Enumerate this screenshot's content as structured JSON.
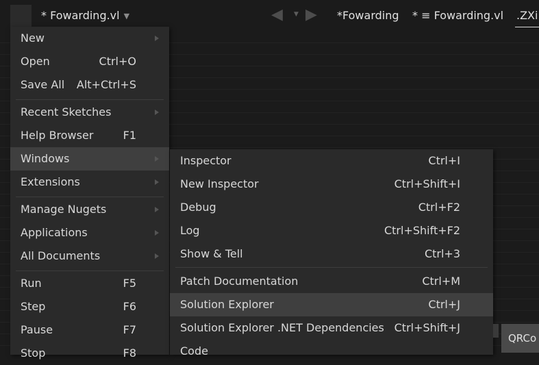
{
  "tabs": {
    "current": "* Fowarding.vl",
    "right_tab_1": "*Fowarding",
    "right_tab_2": "* ≡ Fowarding.vl",
    "right_tab_3": ".ZXi"
  },
  "main_menu": {
    "items": [
      {
        "label": "New",
        "shortcut": "",
        "submenu": true
      },
      {
        "label": "Open",
        "shortcut": "Ctrl+O",
        "submenu": false
      },
      {
        "label": "Save All",
        "shortcut": "Alt+Ctrl+S",
        "submenu": false
      },
      {
        "label": "Recent Sketches",
        "shortcut": "",
        "submenu": true
      },
      {
        "label": "Help Browser",
        "shortcut": "F1",
        "submenu": false
      },
      {
        "label": "Windows",
        "shortcut": "",
        "submenu": true
      },
      {
        "label": "Extensions",
        "shortcut": "",
        "submenu": true
      },
      {
        "label": "Manage Nugets",
        "shortcut": "",
        "submenu": true
      },
      {
        "label": "Applications",
        "shortcut": "",
        "submenu": true
      },
      {
        "label": "All Documents",
        "shortcut": "",
        "submenu": true
      },
      {
        "label": "Run",
        "shortcut": "F5",
        "submenu": false
      },
      {
        "label": "Step",
        "shortcut": "F6",
        "submenu": false
      },
      {
        "label": "Pause",
        "shortcut": "F7",
        "submenu": false
      },
      {
        "label": "Stop",
        "shortcut": "F8",
        "submenu": false
      }
    ]
  },
  "windows_submenu": {
    "items": [
      {
        "label": "Inspector",
        "shortcut": "Ctrl+I"
      },
      {
        "label": "New Inspector",
        "shortcut": "Ctrl+Shift+I"
      },
      {
        "label": "Debug",
        "shortcut": "Ctrl+F2"
      },
      {
        "label": "Log",
        "shortcut": "Ctrl+Shift+F2"
      },
      {
        "label": "Show & Tell",
        "shortcut": "Ctrl+3"
      },
      {
        "label": "Patch Documentation",
        "shortcut": "Ctrl+M"
      },
      {
        "label": "Solution Explorer",
        "shortcut": "Ctrl+J"
      },
      {
        "label": "Solution Explorer .NET Dependencies",
        "shortcut": "Ctrl+Shift+J"
      },
      {
        "label": "Code",
        "shortcut": ""
      }
    ]
  },
  "qr_button": {
    "label": "QRCo"
  },
  "colors": {
    "background": "#1b1b1b",
    "menu": "#2a2a2a",
    "highlight": "#3f3f3f",
    "text": "#d8d8d8"
  }
}
